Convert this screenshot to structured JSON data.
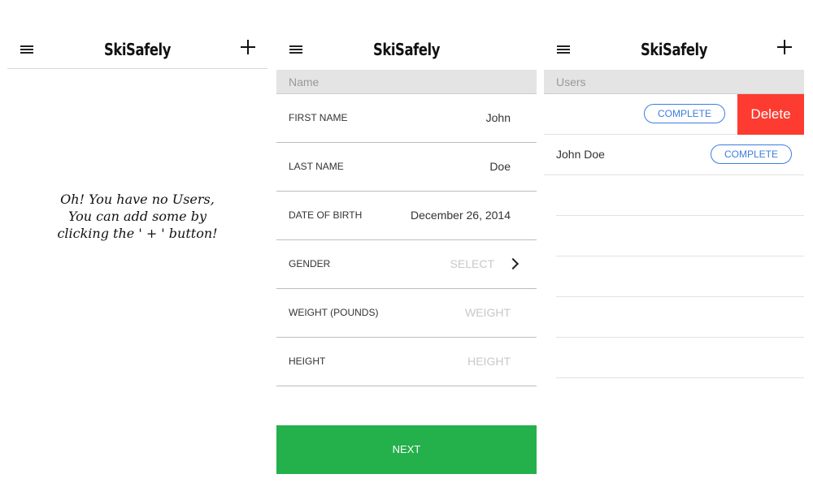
{
  "app": {
    "brand": "SkiSafely"
  },
  "screen1": {
    "empty_message": [
      "Oh! You have no Users,",
      "You can add some by",
      "clicking the ' + ' button!"
    ]
  },
  "screen2": {
    "section_header": "Name",
    "fields": [
      {
        "label": "FIRST NAME",
        "value": "John",
        "placeholder": ""
      },
      {
        "label": "LAST NAME",
        "value": "Doe",
        "placeholder": ""
      },
      {
        "label": "DATE OF BIRTH",
        "value": "December 26, 2014",
        "placeholder": ""
      },
      {
        "label": "GENDER",
        "value": "",
        "placeholder": "SELECT"
      },
      {
        "label": "WEIGHT (POUNDS)",
        "value": "",
        "placeholder": "WEIGHT"
      },
      {
        "label": "HEIGHT",
        "value": "",
        "placeholder": "HEIGHT"
      }
    ],
    "next_label": "NEXT"
  },
  "screen3": {
    "section_header": "Users",
    "rows": [
      {
        "name": "",
        "status": "COMPLETE",
        "delete_label": "Delete"
      },
      {
        "name": "John Doe",
        "status": "COMPLETE"
      }
    ]
  },
  "colors": {
    "accent_green": "#24b04a",
    "delete_red": "#fd3b30",
    "pill_blue": "#3d7de0"
  }
}
